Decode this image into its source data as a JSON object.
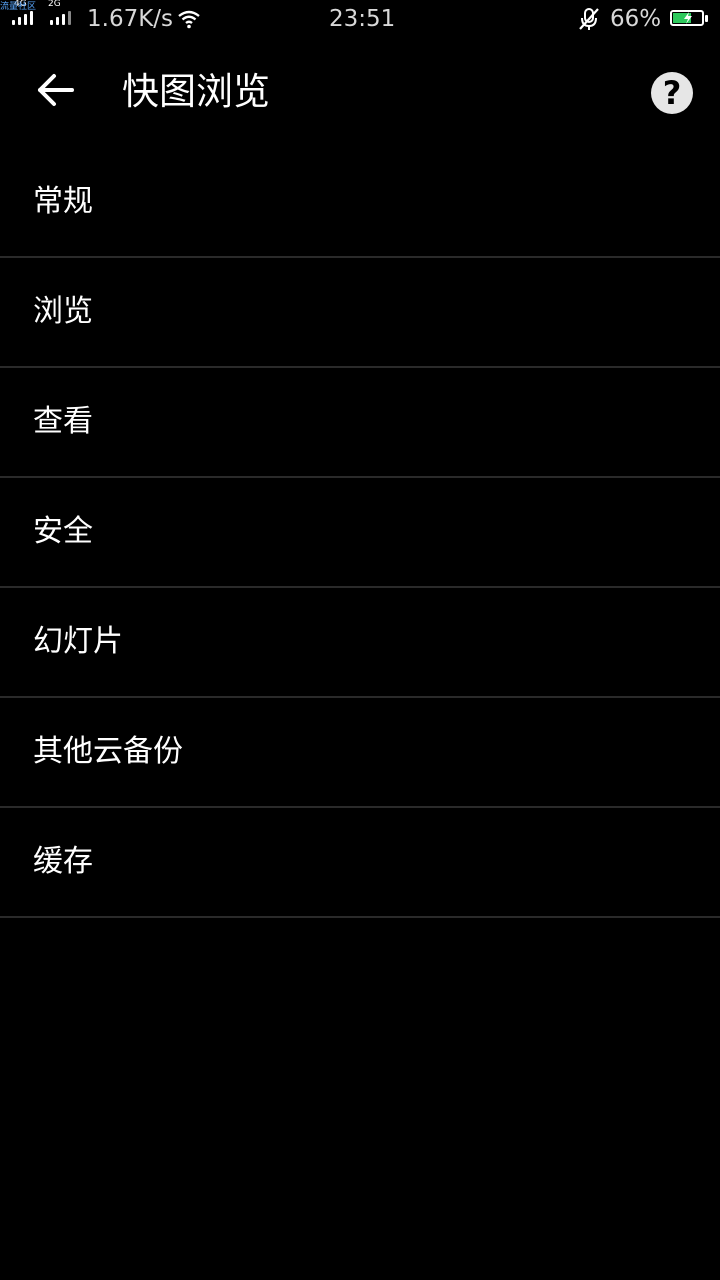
{
  "status_bar": {
    "network_1": "4G",
    "network_2": "2G",
    "carrier_overlay": "流量社区",
    "speed": "1.67K/s",
    "time": "23:51",
    "battery_percent": "66%",
    "battery_level": 0.66,
    "battery_color": "#2ec95d"
  },
  "app_bar": {
    "title": "快图浏览",
    "help_label": "?"
  },
  "settings": {
    "items": [
      {
        "label": "常规"
      },
      {
        "label": "浏览"
      },
      {
        "label": "查看"
      },
      {
        "label": "安全"
      },
      {
        "label": "幻灯片"
      },
      {
        "label": "其他云备份"
      },
      {
        "label": "缓存"
      }
    ]
  }
}
